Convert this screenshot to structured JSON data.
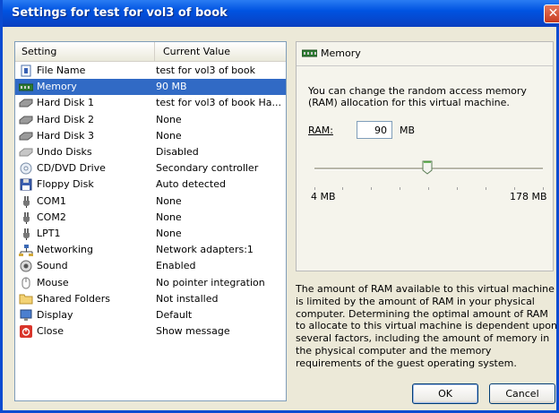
{
  "window": {
    "title": "Settings for test for vol3 of book",
    "close_glyph": "✕"
  },
  "table": {
    "headers": {
      "setting": "Setting",
      "value": "Current Value"
    },
    "rows": [
      {
        "icon": "file-icon",
        "name": "File Name",
        "value": "test for vol3 of book",
        "selected": false
      },
      {
        "icon": "memory-icon",
        "name": "Memory",
        "value": "90 MB",
        "selected": true
      },
      {
        "icon": "hard-disk-icon",
        "name": "Hard Disk 1",
        "value": "test for vol3 of book Ha...",
        "selected": false
      },
      {
        "icon": "hard-disk-icon",
        "name": "Hard Disk 2",
        "value": "None",
        "selected": false
      },
      {
        "icon": "hard-disk-icon",
        "name": "Hard Disk 3",
        "value": "None",
        "selected": false
      },
      {
        "icon": "undo-disk-icon",
        "name": "Undo Disks",
        "value": "Disabled",
        "selected": false
      },
      {
        "icon": "cd-dvd-icon",
        "name": "CD/DVD Drive",
        "value": "Secondary controller",
        "selected": false
      },
      {
        "icon": "floppy-icon",
        "name": "Floppy Disk",
        "value": "Auto detected",
        "selected": false
      },
      {
        "icon": "port-icon",
        "name": "COM1",
        "value": "None",
        "selected": false
      },
      {
        "icon": "port-icon",
        "name": "COM2",
        "value": "None",
        "selected": false
      },
      {
        "icon": "port-icon",
        "name": "LPT1",
        "value": "None",
        "selected": false
      },
      {
        "icon": "network-icon",
        "name": "Networking",
        "value": "Network adapters:1",
        "selected": false
      },
      {
        "icon": "speaker-icon",
        "name": "Sound",
        "value": "Enabled",
        "selected": false
      },
      {
        "icon": "mouse-icon",
        "name": "Mouse",
        "value": "No pointer integration",
        "selected": false
      },
      {
        "icon": "folder-icon",
        "name": "Shared Folders",
        "value": "Not installed",
        "selected": false
      },
      {
        "icon": "display-icon",
        "name": "Display",
        "value": "Default",
        "selected": false
      },
      {
        "icon": "power-icon",
        "name": "Close",
        "value": "Show message",
        "selected": false
      }
    ]
  },
  "detail": {
    "heading": "Memory",
    "description": "You can change the random access memory (RAM) allocation for this virtual machine.",
    "ram_label": "RAM:",
    "ram_value": "90",
    "ram_unit": "MB",
    "slider": {
      "min_label": "4 MB",
      "max_label": "178 MB",
      "value_mb": 90,
      "min_mb": 4,
      "max_mb": 178
    }
  },
  "help_text": "The amount of RAM available to this virtual machine is limited by the amount of RAM in your physical computer. Determining the optimal amount of RAM to allocate to this virtual machine is dependent upon several factors, including the amount of memory in the physical computer and the memory requirements of the guest operating system.",
  "buttons": {
    "ok": "OK",
    "cancel": "Cancel"
  },
  "colors": {
    "selection": "#316ac5",
    "titlebar": "#0053e1"
  }
}
